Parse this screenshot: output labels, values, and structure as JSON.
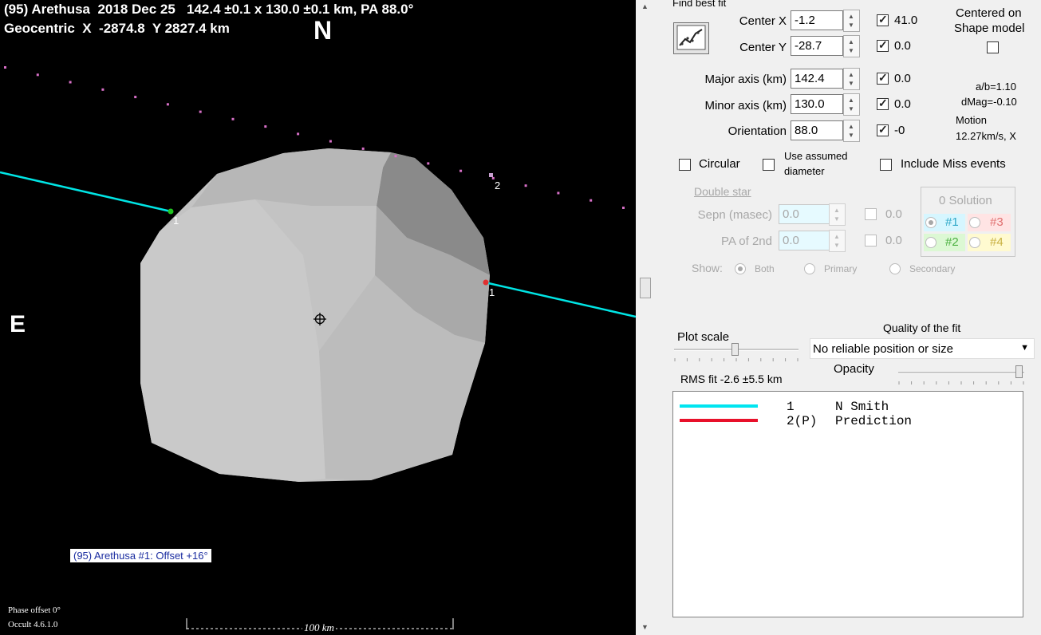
{
  "plot": {
    "header_line1": "(95) Arethusa  2018 Dec 25   142.4 ±0.1 x 130.0 ±0.1 km, PA 88.0°",
    "header_line2": "Geocentric  X  -2874.8  Y 2827.4 km",
    "north_label": "N",
    "east_label": "E",
    "chord1_label_a": "1",
    "chord1_label_b": "1",
    "chord2_label": "2",
    "offset_label": "(95) Arethusa #1: Offset +16°",
    "phase_offset": "Phase offset 0°",
    "version": "Occult 4.6.1.0",
    "scale_label": "100 km",
    "colors": {
      "chord1": "#00e5e5",
      "chord2_dots": "#d870c8",
      "shape": "#c0c0c0",
      "background": "#000000"
    }
  },
  "panel": {
    "find_best_fit": "Find best fit",
    "center_x_label": "Center X",
    "center_x_value": "-1.2",
    "center_x_check": "41.0",
    "center_y_label": "Center Y",
    "center_y_value": "-28.7",
    "center_y_check": "0.0",
    "centered_on_line1": "Centered on",
    "centered_on_line2": "Shape model",
    "major_label": "Major axis (km)",
    "major_value": "142.4",
    "major_check": "0.0",
    "minor_label": "Minor axis (km)",
    "minor_value": "130.0",
    "minor_check": "0.0",
    "orient_label": "Orientation",
    "orient_value": "88.0",
    "orient_check": "-0",
    "ab_ratio": "a/b=1.10",
    "dmag": "dMag=-0.10",
    "motion_label": "Motion",
    "motion_value": "12.27km/s, X",
    "circular": "Circular",
    "use_assumed_line1": "Use assumed",
    "use_assumed_line2": "diameter",
    "include_miss": "Include Miss events",
    "double_star": "Double star",
    "sepn_label": "Sepn (masec)",
    "sepn_value": "0.0",
    "sepn_check": "0.0",
    "pa2_label": "PA of 2nd",
    "pa2_value": "0.0",
    "pa2_check": "0.0",
    "solution_title": "0 Solution",
    "sol1": "#1",
    "sol2": "#2",
    "sol3": "#3",
    "sol4": "#4",
    "show_label": "Show:",
    "show_both": "Both",
    "show_primary": "Primary",
    "show_secondary": "Secondary",
    "plot_scale": "Plot scale",
    "quality_label": "Quality of the fit",
    "quality_value": "No reliable position or size",
    "opacity_label": "Opacity",
    "rms_fit": "RMS fit  -2.6 ±5.5 km",
    "legend": [
      {
        "num": "1",
        "name": "N Smith",
        "color": "#00e5f0"
      },
      {
        "num": "2(P)",
        "name": "Prediction",
        "color": "#e8102a"
      }
    ]
  }
}
